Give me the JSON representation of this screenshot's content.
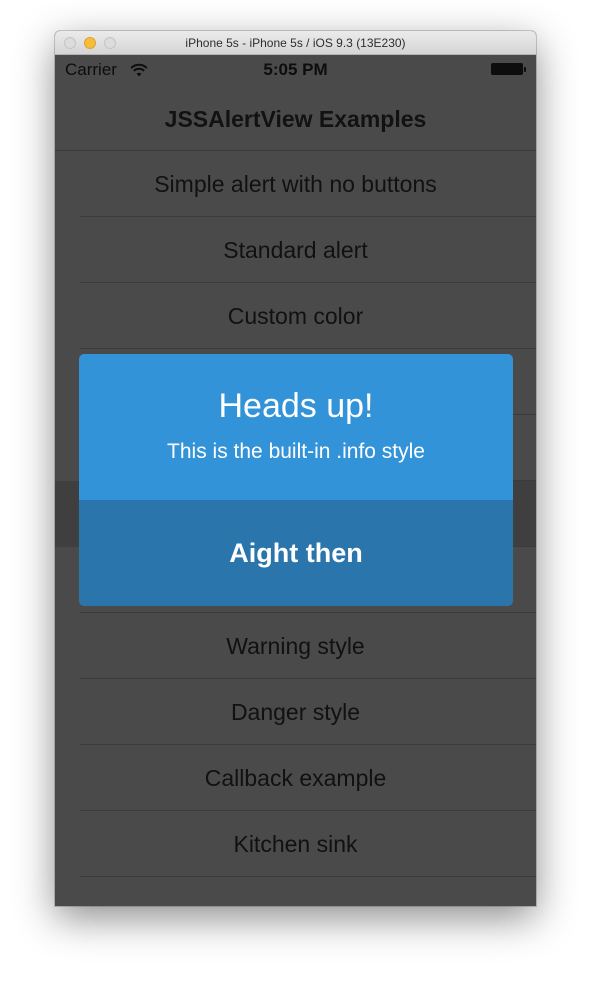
{
  "window": {
    "title": "iPhone 5s - iPhone 5s / iOS 9.3 (13E230)"
  },
  "status_bar": {
    "carrier": "Carrier",
    "time": "5:05 PM"
  },
  "nav": {
    "title": "JSSAlertView Examples"
  },
  "table": {
    "rows": [
      {
        "label": "Simple alert with no buttons"
      },
      {
        "label": "Standard alert"
      },
      {
        "label": "Custom color"
      },
      {
        "label": ""
      },
      {
        "label": ""
      },
      {
        "label": ""
      },
      {
        "label": ""
      },
      {
        "label": "Warning style"
      },
      {
        "label": "Danger style"
      },
      {
        "label": "Callback example"
      },
      {
        "label": "Kitchen sink"
      }
    ]
  },
  "alert": {
    "title": "Heads up!",
    "text": "This is the built-in .info style",
    "button_label": "Aight then",
    "color": "#3393d8",
    "button_color": "#2a75ab"
  },
  "colors": {
    "dimmed_background": "#4a4a4a",
    "selected_row": "#3f3f3f"
  }
}
